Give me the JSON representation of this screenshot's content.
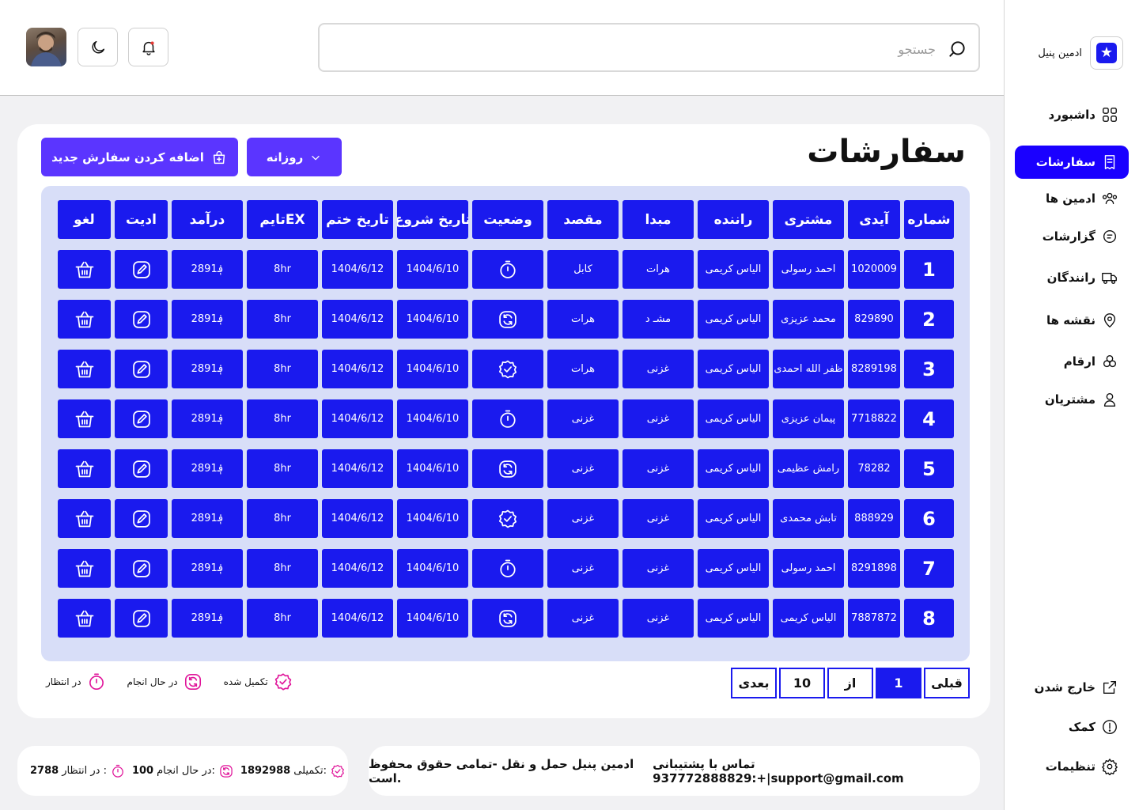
{
  "colors": {
    "primary": "#1a1aee",
    "accent": "#5b35ff",
    "active_nav": "#1a00ff",
    "status": "#e0159a"
  },
  "brand": {
    "name": "ادمین پنیل",
    "logo_icon": "star-icon"
  },
  "nav": [
    {
      "label": "داشبورد",
      "icon": "dashboard-grid-icon"
    },
    {
      "label": "سفارشات",
      "icon": "receipt-icon",
      "active": true
    },
    {
      "label": "ادمین ها",
      "icon": "users-group-icon"
    },
    {
      "label": "گزارشات",
      "icon": "report-icon"
    },
    {
      "label": "رانندگان",
      "icon": "truck-icon"
    },
    {
      "label": "نقشه ها",
      "icon": "map-pin-icon"
    },
    {
      "label": "ارقام",
      "icon": "stats-icon"
    },
    {
      "label": "مشتریان",
      "icon": "user-icon"
    }
  ],
  "nav_bottom": [
    {
      "label": "خارج شدن",
      "icon": "logout-icon"
    },
    {
      "label": "کمک",
      "icon": "help-icon"
    },
    {
      "label": "تنظیمات",
      "icon": "gear-icon"
    }
  ],
  "header": {
    "search_placeholder": "جستجو"
  },
  "page": {
    "title": "سفارشات",
    "add_button": "اضافه کردن سفارش جدید",
    "period_select": "روزانه"
  },
  "table": {
    "headers": [
      "شماره",
      "آیدی",
      "مشتری",
      "راننده",
      "مبدا",
      "مقصد",
      "وضعیت",
      "تاریخ شروع",
      "تاریخ ختم",
      "تایمEX",
      "درآمد",
      "ادیت",
      "لغو"
    ],
    "rows": [
      {
        "num": "1",
        "id": "1020009",
        "customer": "احمد رسولی",
        "driver": "الیاس کریمی",
        "origin": "هرات",
        "dest": "کابل",
        "status": "pending",
        "start": "1404/6/10",
        "end": "1404/6/12",
        "time": "8hr",
        "income": "2891؋"
      },
      {
        "num": "2",
        "id": "829890",
        "customer": "محمد عزیزی",
        "driver": "الیاس کریمی",
        "origin": "مشـ د",
        "dest": "هرات",
        "status": "in_progress",
        "start": "1404/6/10",
        "end": "1404/6/12",
        "time": "8hr",
        "income": "2891؋"
      },
      {
        "num": "3",
        "id": "8289198",
        "customer": "ظفر الله احمدی",
        "driver": "الیاس کریمی",
        "origin": "غزنی",
        "dest": "هرات",
        "status": "done",
        "start": "1404/6/10",
        "end": "1404/6/12",
        "time": "8hr",
        "income": "2891؋"
      },
      {
        "num": "4",
        "id": "7718822",
        "customer": "پیمان عزیزی",
        "driver": "الیاس کریمی",
        "origin": "غزنی",
        "dest": "غزنی",
        "status": "pending",
        "start": "1404/6/10",
        "end": "1404/6/12",
        "time": "8hr",
        "income": "2891؋"
      },
      {
        "num": "5",
        "id": "78282",
        "customer": "رامش عظیمی",
        "driver": "الیاس کریمی",
        "origin": "غزنی",
        "dest": "غزنی",
        "status": "in_progress",
        "start": "1404/6/10",
        "end": "1404/6/12",
        "time": "8hr",
        "income": "2891؋"
      },
      {
        "num": "6",
        "id": "888929",
        "customer": "تابش محمدی",
        "driver": "الیاس کریمی",
        "origin": "غزنی",
        "dest": "غزنی",
        "status": "done",
        "start": "1404/6/10",
        "end": "1404/6/12",
        "time": "8hr",
        "income": "2891؋"
      },
      {
        "num": "7",
        "id": "8291898",
        "customer": "احمد رسولی",
        "driver": "الیاس کریمی",
        "origin": "غزنی",
        "dest": "غزنی",
        "status": "pending",
        "start": "1404/6/10",
        "end": "1404/6/12",
        "time": "8hr",
        "income": "2891؋"
      },
      {
        "num": "8",
        "id": "7887872",
        "customer": "الیاس کریمی",
        "driver": "الیاس کریمی",
        "origin": "غزنی",
        "dest": "غزنی",
        "status": "in_progress",
        "start": "1404/6/10",
        "end": "1404/6/12",
        "time": "8hr",
        "income": "2891؋"
      }
    ]
  },
  "pagination": {
    "prev": "قبلی",
    "current": "1",
    "of": "از",
    "total": "10",
    "next": "بعدی"
  },
  "legend": [
    {
      "label": "در انتظار",
      "status": "pending"
    },
    {
      "label": "در حال انجام",
      "status": "in_progress"
    },
    {
      "label": "تکمیل شده",
      "status": "done"
    }
  ],
  "footer": {
    "contact": "تماس با پشتیبانی :937772888829+|support@gmail.com",
    "copyright": "ادمین پنیل حمل و نقل -تمامی حقوق محفوظ است.",
    "stats": [
      {
        "label": "تکمیلی:",
        "value": "1892988",
        "status": "done"
      },
      {
        "label": "در حال انجام:",
        "value": "100",
        "status": "in_progress"
      },
      {
        "label": "در انتظار :",
        "value": "2788",
        "status": "pending"
      }
    ]
  }
}
